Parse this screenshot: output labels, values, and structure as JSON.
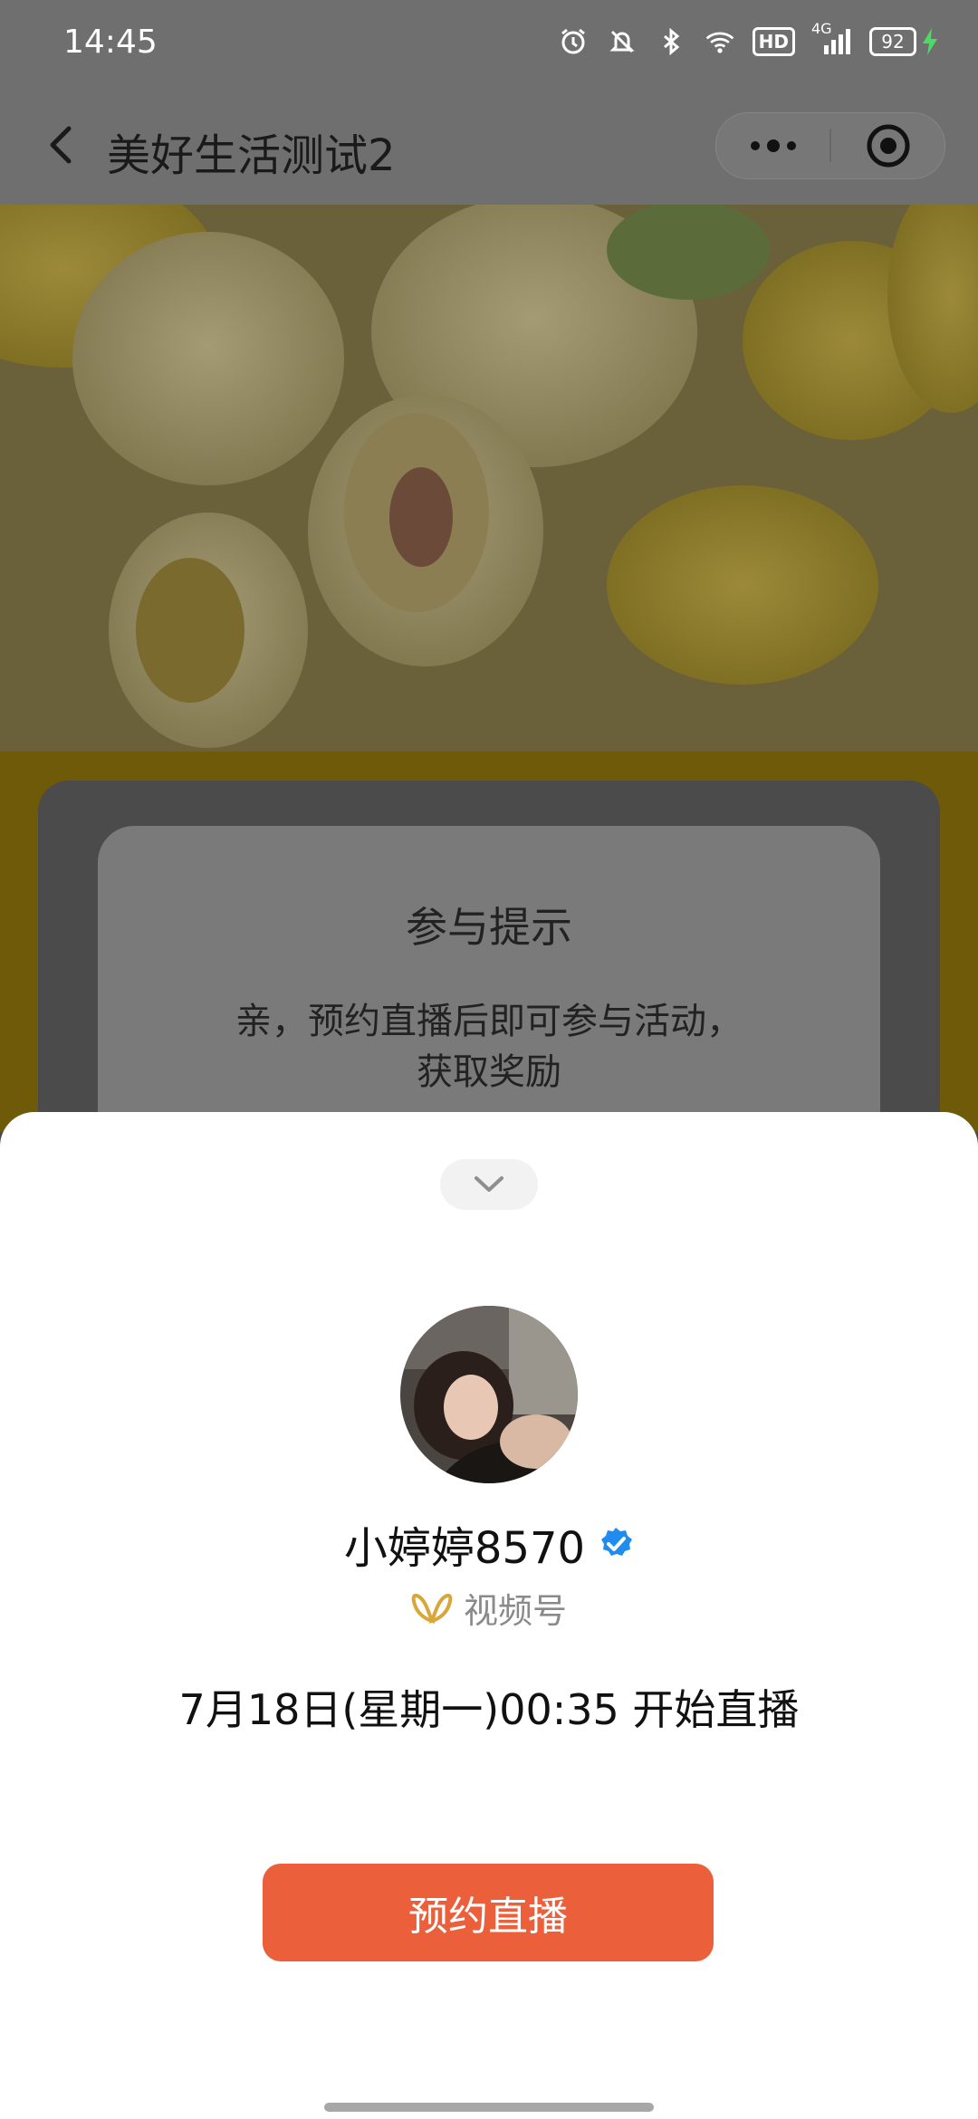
{
  "status_bar": {
    "time": "14:45",
    "network": "4G",
    "hd_label": "HD",
    "battery": "92",
    "icons": [
      "alarm-icon",
      "mute-icon",
      "bluetooth-icon",
      "wifi-icon",
      "hd-icon",
      "signal-icon",
      "battery-icon",
      "charging-icon"
    ]
  },
  "nav": {
    "title": "美好生活测试2",
    "icons": [
      "back-icon",
      "more-icon",
      "close-target-icon"
    ]
  },
  "tip_card": {
    "title": "参与提示",
    "line1": "亲，预约直播后即可参与活动，",
    "line2": "获取奖励"
  },
  "sheet": {
    "collapse_icon": "chevron-down-icon",
    "host_name": "小婷婷8570",
    "verified_icon": "verified-badge-icon",
    "channel_icon": "channels-butterfly-icon",
    "channel_label": "视频号",
    "schedule": "7月18日(星期一)00:35 开始直播",
    "reserve_button": "预约直播"
  },
  "colors": {
    "accent": "#eb5f3a",
    "verified": "#1f8cf0",
    "channel_gold": "#d9a63a"
  }
}
